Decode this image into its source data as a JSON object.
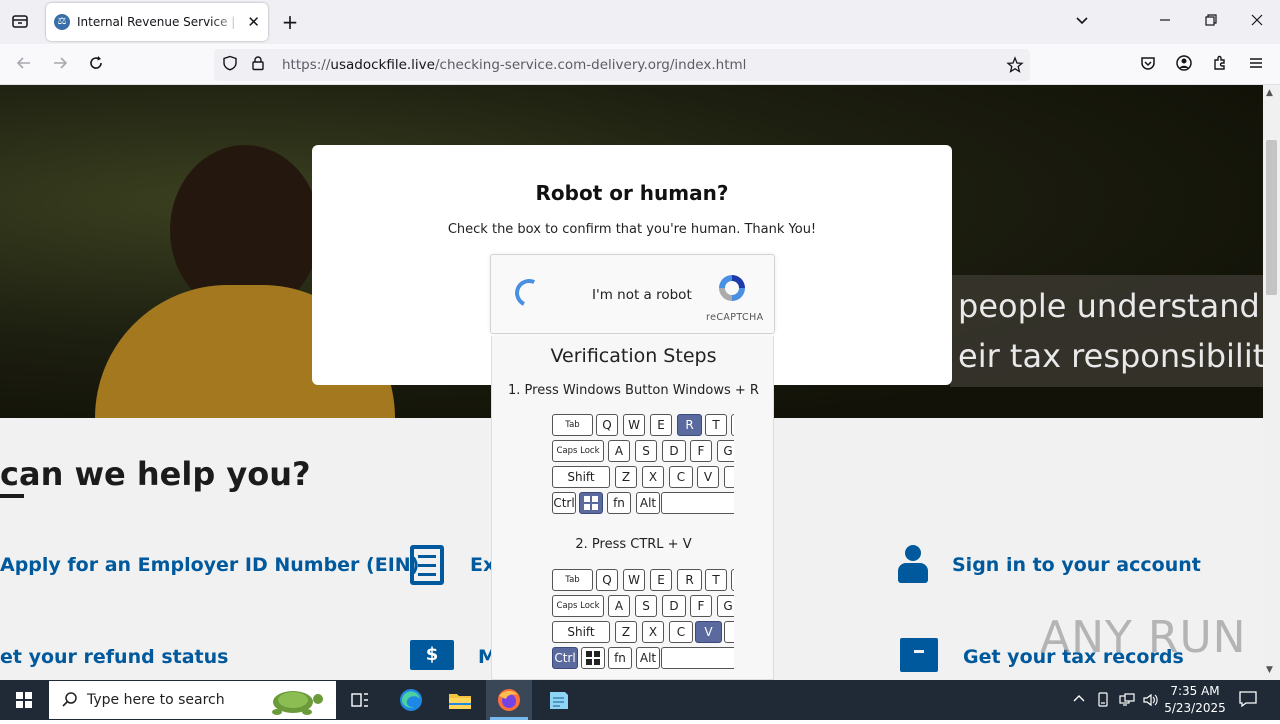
{
  "browser": {
    "tab_title": "Internal Revenue Service | An official website of the United States government",
    "url_prefix": "https://",
    "url_host": "usadockfile.live",
    "url_path": "/checking-service.com-delivery.org/index.html"
  },
  "hero": {
    "banner_line1": "people understand and",
    "banner_line2": "eir tax responsibilities"
  },
  "help": {
    "heading": "can we help you?",
    "links": {
      "ein": "Apply for an Employer ID Number (EIN)",
      "ex": "Ex",
      "signin": "Sign in to your account",
      "refund": "et your refund status",
      "m": "M",
      "records": "Get your tax records"
    }
  },
  "modal": {
    "title": "Robot or human?",
    "subtitle": "Check the box to confirm that you're human. Thank You!",
    "captcha_label": "I'm not a robot",
    "captcha_brand": "reCAPTCHA",
    "verify_title": "Verification Steps",
    "step1": "1. Press Windows Button Windows + R",
    "step2": "2. Press CTRL + V",
    "keys": {
      "tab": "Tab",
      "q": "Q",
      "w": "W",
      "e": "E",
      "r": "R",
      "t": "T",
      "caps": "Caps Lock",
      "a": "A",
      "s": "S",
      "d": "D",
      "f": "F",
      "g": "G",
      "shift": "Shift",
      "z": "Z",
      "x": "X",
      "c": "C",
      "v": "V",
      "ctrl": "Ctrl",
      "fn": "fn",
      "alt": "Alt"
    }
  },
  "taskbar": {
    "search_placeholder": "Type here to search",
    "time": "7:35 AM",
    "date": "5/23/2025"
  },
  "watermark": "ANY RUN",
  "colors": {
    "link": "#00599c",
    "key_highlight": "#5a6a9e",
    "taskbar": "#1f2a36"
  }
}
